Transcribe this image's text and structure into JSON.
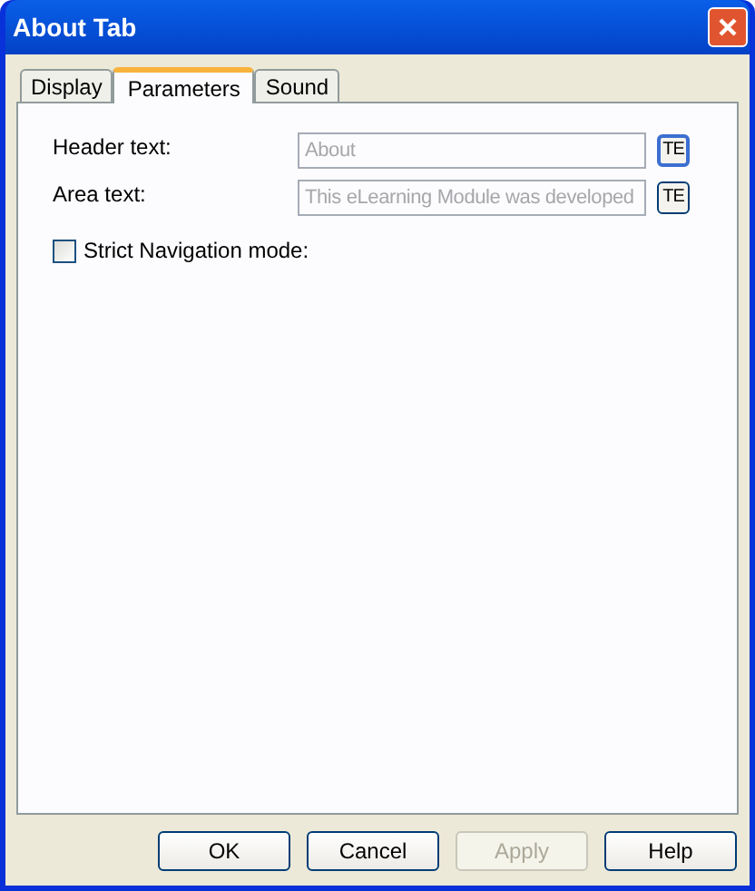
{
  "window": {
    "title": "About Tab"
  },
  "tabs": [
    {
      "label": "Display",
      "selected": false
    },
    {
      "label": "Parameters",
      "selected": true
    },
    {
      "label": "Sound",
      "selected": false
    }
  ],
  "fields": [
    {
      "label": "Header text:",
      "value": "About",
      "disabled": true,
      "button": "TE",
      "focused": true
    },
    {
      "label": "Area text:",
      "value": "This eLearning Module was developed",
      "disabled": true,
      "button": "TE",
      "focused": false
    }
  ],
  "checkbox": {
    "label": "Strict Navigation mode:",
    "checked": false
  },
  "buttons": [
    {
      "label": "OK",
      "disabled": false
    },
    {
      "label": "Cancel",
      "disabled": false
    },
    {
      "label": "Apply",
      "disabled": true
    },
    {
      "label": "Help",
      "disabled": false
    }
  ]
}
